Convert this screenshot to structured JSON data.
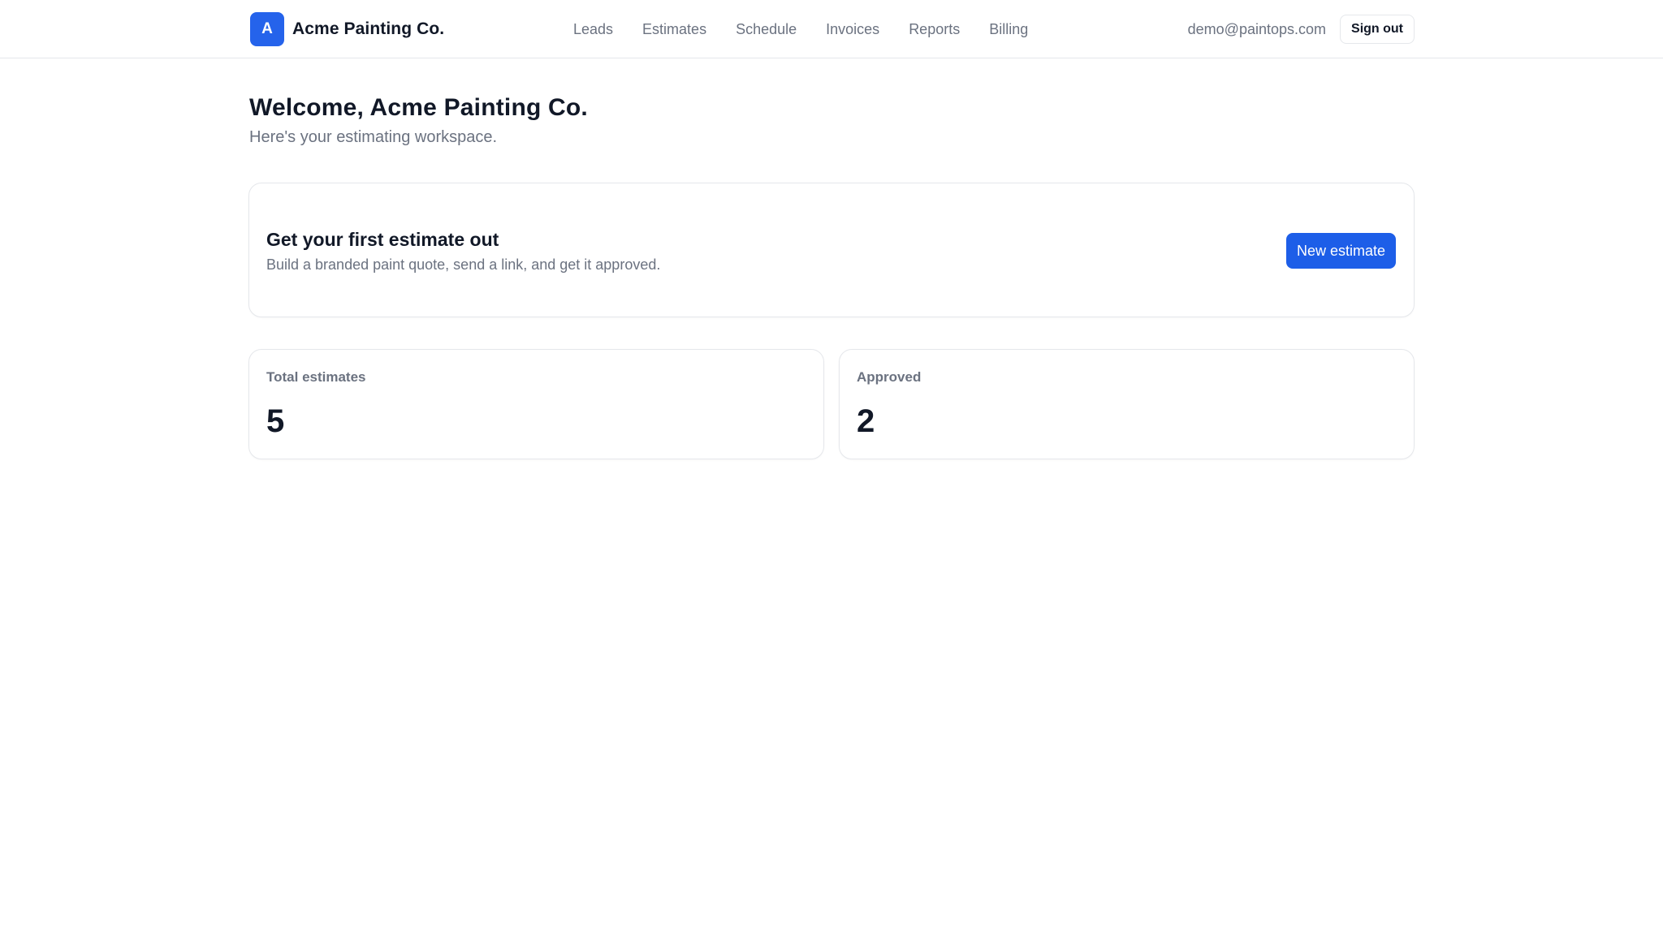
{
  "brand": {
    "logo_letter": "A",
    "name": "Acme Painting Co."
  },
  "nav": {
    "items": [
      {
        "label": "Leads"
      },
      {
        "label": "Estimates"
      },
      {
        "label": "Schedule"
      },
      {
        "label": "Invoices"
      },
      {
        "label": "Reports"
      },
      {
        "label": "Billing"
      }
    ]
  },
  "account": {
    "email": "demo@paintops.com",
    "signout_label": "Sign out"
  },
  "welcome": {
    "title": "Welcome, Acme Painting Co.",
    "subtitle": "Here's your estimating workspace."
  },
  "promo": {
    "title": "Get your first estimate out",
    "description": "Build a branded paint quote, send a link, and get it approved.",
    "button_label": "New estimate"
  },
  "stats": [
    {
      "label": "Total estimates",
      "value": "5"
    },
    {
      "label": "Approved",
      "value": "2"
    }
  ],
  "colors": {
    "accent": "#2563eb",
    "primary_button": "#1d5ee8",
    "text": "#111827",
    "muted": "#6b7280",
    "border": "#e5e7eb"
  }
}
